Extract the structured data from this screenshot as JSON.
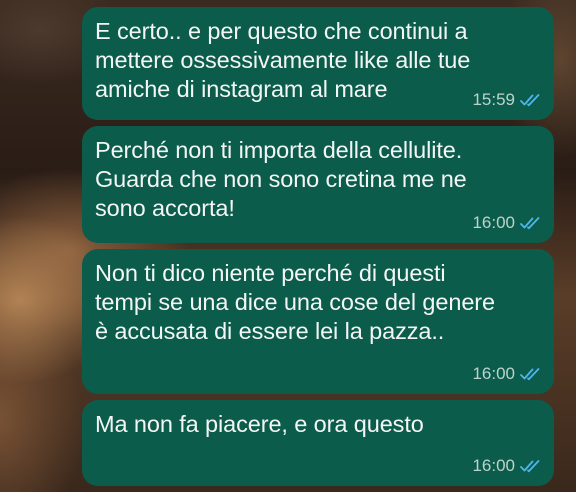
{
  "messages": [
    {
      "text": "E certo.. e per questo che continui a\nmettere ossessivamente like alle tue\namiche di instagram al mare",
      "time": "15:59",
      "status": "read"
    },
    {
      "text": "Perché non ti importa della cellulite.\nGuarda che non sono cretina me ne\nsono accorta!",
      "time": "16:00",
      "status": "read"
    },
    {
      "text": "Non ti dico niente perché di questi\ntempi se una dice una cose del genere\nè accusata di essere lei la pazza..",
      "time": "16:00",
      "status": "read"
    },
    {
      "text": "Ma non fa piacere, e ora questo",
      "time": "16:00",
      "status": "read"
    }
  ],
  "colors": {
    "bubble": "#0b5c4b",
    "text": "#f3f6f5",
    "time": "#bcd3cd",
    "read_ticks": "#4fb6ec"
  },
  "icons": {
    "status": "double-check-read-icon"
  }
}
